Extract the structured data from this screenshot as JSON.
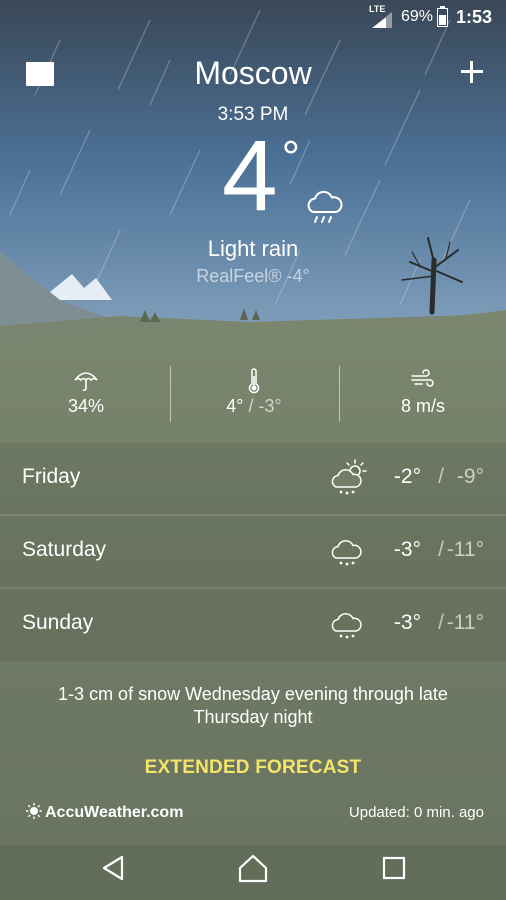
{
  "status_bar": {
    "network": "LTE",
    "battery": "69%",
    "battery_level": 0.69,
    "time": "1:53"
  },
  "header": {
    "city": "Moscow",
    "local_time": "3:53 PM"
  },
  "current": {
    "temperature": "4",
    "degree": "°",
    "condition": "Light rain",
    "realfeel": "RealFeel® -4°",
    "icon": "cloud-rain-icon"
  },
  "stats": {
    "precip": {
      "icon": "umbrella-icon",
      "value": "34%"
    },
    "temp_range": {
      "icon": "thermometer-icon",
      "high": "4°",
      "sep": " / ",
      "low": "-3°"
    },
    "wind": {
      "icon": "wind-icon",
      "value": "8 m/s"
    }
  },
  "forecast": [
    {
      "day": "Friday",
      "icon": "partly-sunny-snow-icon",
      "high": "-2°",
      "low": "-9°"
    },
    {
      "day": "Saturday",
      "icon": "cloud-snow-icon",
      "high": "-3°",
      "low": "-11°"
    },
    {
      "day": "Sunday",
      "icon": "cloud-snow-icon",
      "high": "-3°",
      "low": "-11°"
    }
  ],
  "temp_sep": "/",
  "note": "1-3 cm of snow Wednesday evening through late Thursday night",
  "extended_label": "EXTENDED FORECAST",
  "footer": {
    "brand": "AccuWeather.com",
    "updated": "Updated: 0 min. ago"
  },
  "colors": {
    "accent": "#f2e56a",
    "sky_top": "#3b4b60",
    "sky_mid": "#4d7aa3",
    "ground": "#6f7a64"
  }
}
